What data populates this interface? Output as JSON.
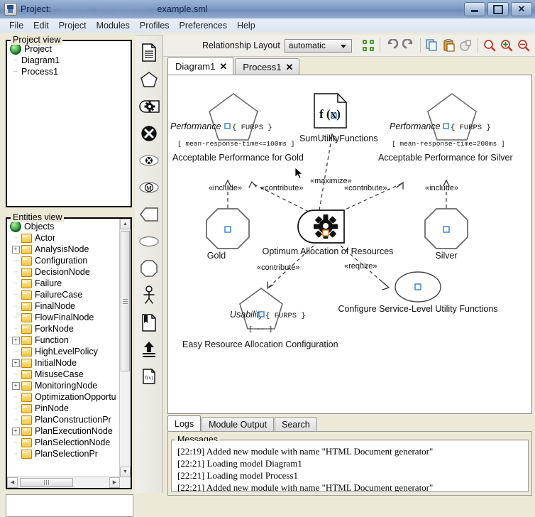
{
  "window": {
    "title_prefix": "Project:",
    "title_path_redacted": "C:\\Users\\...\\Documents\\...\\",
    "title_file": "example.sml",
    "app_icon": "java-coffee-cup-icon",
    "buttons": {
      "minimize": "minimize-icon",
      "maximize": "maximize-icon",
      "close": "close-icon"
    }
  },
  "menubar": {
    "items": [
      "File",
      "Edit",
      "Project",
      "Modules",
      "Profiles",
      "Preferences",
      "Help"
    ]
  },
  "project_view": {
    "title": "Project view",
    "root": "Project",
    "children": [
      "Diagram1",
      "Process1"
    ]
  },
  "entities_view": {
    "title": "Entities view",
    "root": "Objects",
    "items": [
      {
        "label": "Actor",
        "expandable": false
      },
      {
        "label": "AnalysisNode",
        "expandable": true
      },
      {
        "label": "Configuration",
        "expandable": false
      },
      {
        "label": "DecisionNode",
        "expandable": false
      },
      {
        "label": "Failure",
        "expandable": false
      },
      {
        "label": "FailureCase",
        "expandable": false
      },
      {
        "label": "FinalNode",
        "expandable": false
      },
      {
        "label": "FlowFinalNode",
        "expandable": false
      },
      {
        "label": "ForkNode",
        "expandable": false
      },
      {
        "label": "Function",
        "expandable": true
      },
      {
        "label": "HighLevelPolicy",
        "expandable": false
      },
      {
        "label": "InitialNode",
        "expandable": true
      },
      {
        "label": "MisuseCase",
        "expandable": false
      },
      {
        "label": "MonitoringNode",
        "expandable": true
      },
      {
        "label": "OptimizationOpportu",
        "expandable": false
      },
      {
        "label": "PinNode",
        "expandable": false
      },
      {
        "label": "PlanConstructionPr",
        "expandable": false
      },
      {
        "label": "PlanExecutionNode",
        "expandable": true
      },
      {
        "label": "PlanSelectionNode",
        "expandable": false
      },
      {
        "label": "PlanSelectionPr",
        "expandable": false
      }
    ]
  },
  "palette": {
    "tools": [
      {
        "name": "document-icon",
        "title": "Document"
      },
      {
        "name": "pentagon-icon",
        "title": "Pentagon / Quality"
      },
      {
        "name": "gear-capsule-icon",
        "title": "Process"
      },
      {
        "name": "x-circle-icon",
        "title": "Final node"
      },
      {
        "name": "x-circle-oval-icon",
        "title": "Flow final"
      },
      {
        "name": "m-oval-icon",
        "title": "Monitoring node"
      },
      {
        "name": "pin-node-icon",
        "title": "Pin node"
      },
      {
        "name": "ellipse-icon",
        "title": "Ellipse"
      },
      {
        "name": "octagon-icon",
        "title": "Octagon"
      },
      {
        "name": "actor-icon",
        "title": "Actor"
      },
      {
        "name": "artifact-icon",
        "title": "Artifact"
      },
      {
        "name": "fork-arrow-icon",
        "title": "Fork node"
      },
      {
        "name": "function-fx-icon",
        "title": "Function f(x)"
      }
    ]
  },
  "toolbar": {
    "relationship_layout_label": "Relationship Layout",
    "relationship_layout_value": "automatic",
    "relationship_layout_options": [
      "automatic"
    ],
    "buttons": [
      {
        "name": "fit-layout-icon",
        "title": "Fit layout"
      },
      {
        "name": "undo-icon",
        "title": "Undo"
      },
      {
        "name": "redo-icon",
        "title": "Redo"
      },
      {
        "name": "copy-icon",
        "title": "Copy"
      },
      {
        "name": "paste-icon",
        "title": "Paste"
      },
      {
        "name": "cut-icon",
        "title": "Cut"
      },
      {
        "name": "zoom-icon",
        "title": "Zoom"
      },
      {
        "name": "zoom-in-icon",
        "title": "Zoom in"
      },
      {
        "name": "zoom-out-icon",
        "title": "Zoom out"
      }
    ]
  },
  "tabs": [
    {
      "label": "Diagram1",
      "active": true,
      "close": "✕"
    },
    {
      "label": "Process1",
      "active": false,
      "close": "✕"
    }
  ],
  "diagram": {
    "nodes": [
      {
        "id": "perf_gold",
        "shape": "pentagon",
        "name": "Performance",
        "stereotype": "{ FURPS }",
        "guard": "[ mean-response-time<=100ms ]",
        "caption": "Acceptable Performance for Gold"
      },
      {
        "id": "sumutil",
        "shape": "document-fx",
        "name": "f (x)",
        "caption": "SumUtilityFunctions"
      },
      {
        "id": "perf_silver",
        "shape": "pentagon",
        "name": "Performance",
        "stereotype": "{ FURPS }",
        "guard": "[ mean-response-time=200ms ]",
        "caption": "Acceptable Performance for Silver"
      },
      {
        "id": "gold",
        "shape": "octagon",
        "caption": "Gold"
      },
      {
        "id": "silver",
        "shape": "octagon",
        "caption": "Silver"
      },
      {
        "id": "optimum",
        "shape": "gear-capsule",
        "caption": "Optimum Allocation of Resources"
      },
      {
        "id": "usability",
        "shape": "pentagon",
        "name": "Usability",
        "stereotype": "{ FURPS }",
        "guard": "[ -- ]",
        "caption": "Easy Resource Allocation Configuration"
      },
      {
        "id": "configure",
        "shape": "ellipse",
        "caption": "Configure Service-Level Utility Functions"
      }
    ],
    "edges": [
      {
        "from": "gold",
        "to": "perf_gold",
        "label": "«include»"
      },
      {
        "from": "optimum",
        "to": "perf_gold",
        "label": "«contribute»"
      },
      {
        "from": "optimum",
        "to": "sumutil",
        "label": "«maximize»"
      },
      {
        "from": "optimum",
        "to": "perf_silver",
        "label": "«contribute»"
      },
      {
        "from": "silver",
        "to": "perf_silver",
        "label": "«include»"
      },
      {
        "from": "optimum",
        "to": "usability",
        "label": "«contribute»"
      },
      {
        "from": "optimum",
        "to": "configure",
        "label": "«require»"
      }
    ]
  },
  "log": {
    "tabs": [
      {
        "label": "Logs",
        "active": true
      },
      {
        "label": "Module Output",
        "active": false
      },
      {
        "label": "Search",
        "active": false
      }
    ],
    "group_title": "Messages",
    "messages": [
      "[22:19] Added new module with name \"HTML Document generator\"",
      "[22:21] Loading model Diagram1",
      "[22:21] Loading model Process1",
      "[22:21] Added new module with name \"HTML Document generator\""
    ]
  },
  "colors": {
    "title_gradient_top": "#9cb5d6",
    "title_gradient_bottom": "#94aed0",
    "panel_bg": "#ece9d8",
    "canvas_bg": "#ffffff",
    "handle_blue": "#2f7fd0",
    "handle_orange": "#e08020",
    "folder_yellow": "#f5c63d"
  }
}
